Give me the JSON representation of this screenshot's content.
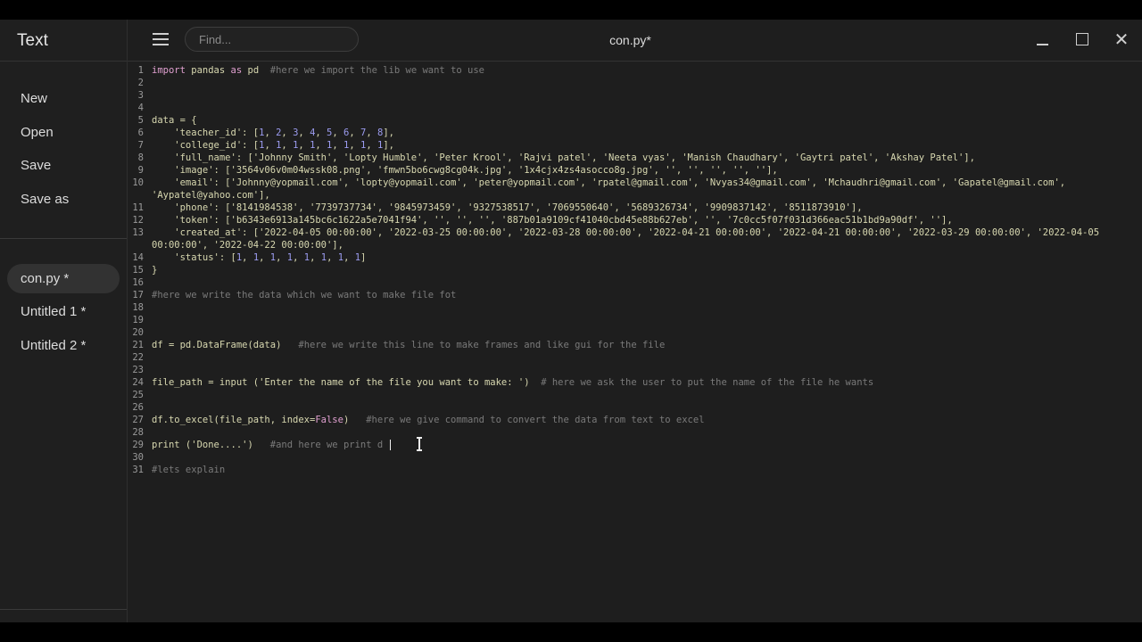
{
  "sidebar": {
    "title": "Text",
    "menu": [
      "New",
      "Open",
      "Save",
      "Save as"
    ],
    "documents": [
      {
        "label": "con.py *",
        "active": true
      },
      {
        "label": "Untitled 1 *",
        "active": false
      },
      {
        "label": "Untitled 2 *",
        "active": false
      }
    ]
  },
  "toolbar": {
    "search_placeholder": "Find...",
    "document_title": "con.py*",
    "close_glyph": "✕"
  },
  "editor": {
    "lines": [
      {
        "n": "1",
        "html": [
          [
            "kw",
            "import"
          ],
          [
            "code",
            " pandas "
          ],
          [
            "kw",
            "as"
          ],
          [
            "code",
            " pd  "
          ],
          [
            "cm",
            "#here we import the lib we want to use"
          ]
        ]
      },
      {
        "n": "2",
        "html": []
      },
      {
        "n": "3",
        "html": []
      },
      {
        "n": "4",
        "html": []
      },
      {
        "n": "5",
        "html": [
          [
            "code",
            "data = {"
          ]
        ]
      },
      {
        "n": "6",
        "html": [
          [
            "code",
            "    'teacher_id': ["
          ],
          [
            "num",
            "1"
          ],
          [
            "code",
            ", "
          ],
          [
            "num",
            "2"
          ],
          [
            "code",
            ", "
          ],
          [
            "num",
            "3"
          ],
          [
            "code",
            ", "
          ],
          [
            "num",
            "4"
          ],
          [
            "code",
            ", "
          ],
          [
            "num",
            "5"
          ],
          [
            "code",
            ", "
          ],
          [
            "num",
            "6"
          ],
          [
            "code",
            ", "
          ],
          [
            "num",
            "7"
          ],
          [
            "code",
            ", "
          ],
          [
            "num",
            "8"
          ],
          [
            "code",
            "],"
          ]
        ]
      },
      {
        "n": "7",
        "html": [
          [
            "code",
            "    'college_id': ["
          ],
          [
            "num",
            "1"
          ],
          [
            "code",
            ", "
          ],
          [
            "num",
            "1"
          ],
          [
            "code",
            ", "
          ],
          [
            "num",
            "1"
          ],
          [
            "code",
            ", "
          ],
          [
            "num",
            "1"
          ],
          [
            "code",
            ", "
          ],
          [
            "num",
            "1"
          ],
          [
            "code",
            ", "
          ],
          [
            "num",
            "1"
          ],
          [
            "code",
            ", "
          ],
          [
            "num",
            "1"
          ],
          [
            "code",
            ", "
          ],
          [
            "num",
            "1"
          ],
          [
            "code",
            "],"
          ]
        ]
      },
      {
        "n": "8",
        "html": [
          [
            "code",
            "    'full_name': ['Johnny Smith', 'Lopty Humble', 'Peter Krool', 'Rajvi patel', 'Neeta vyas', 'Manish Chaudhary', 'Gaytri patel', 'Akshay Patel'],"
          ]
        ]
      },
      {
        "n": "9",
        "html": [
          [
            "code",
            "    'image': ['3564v06v0m04wssk08.png', 'fmwn5bo6cwg8cg04k.jpg', '1x4cjx4zs4asocco8g.jpg', '', '', '', '', ''],"
          ]
        ]
      },
      {
        "n": "10",
        "html": [
          [
            "code",
            "    'email': ['Johnny@yopmail.com', 'lopty@yopmail.com', 'peter@yopmail.com', 'rpatel@gmail.com', 'Nvyas34@gmail.com', 'Mchaudhri@gmail.com', 'Gapatel@gmail.com',"
          ]
        ]
      },
      {
        "n": "",
        "html": [
          [
            "code",
            "'Aypatel@yahoo.com'],"
          ]
        ]
      },
      {
        "n": "11",
        "html": [
          [
            "code",
            "    'phone': ['8141984538', '7739737734', '9845973459', '9327538517', '7069550640', '5689326734', '9909837142', '8511873910'],"
          ]
        ]
      },
      {
        "n": "12",
        "html": [
          [
            "code",
            "    'token': ['b6343e6913a145bc6c1622a5e7041f94', '', '', '', '887b01a9109cf41040cbd45e88b627eb', '', '7c0cc5f07f031d366eac51b1bd9a90df', ''],"
          ]
        ]
      },
      {
        "n": "13",
        "html": [
          [
            "code",
            "    'created_at': ['2022-04-05 00:00:00', '2022-03-25 00:00:00', '2022-03-28 00:00:00', '2022-04-21 00:00:00', '2022-04-21 00:00:00', '2022-03-29 00:00:00', '2022-04-05"
          ]
        ]
      },
      {
        "n": "",
        "html": [
          [
            "code",
            "00:00:00', '2022-04-22 00:00:00'],"
          ]
        ]
      },
      {
        "n": "14",
        "html": [
          [
            "code",
            "    'status': ["
          ],
          [
            "num",
            "1"
          ],
          [
            "code",
            ", "
          ],
          [
            "num",
            "1"
          ],
          [
            "code",
            ", "
          ],
          [
            "num",
            "1"
          ],
          [
            "code",
            ", "
          ],
          [
            "num",
            "1"
          ],
          [
            "code",
            ", "
          ],
          [
            "num",
            "1"
          ],
          [
            "code",
            ", "
          ],
          [
            "num",
            "1"
          ],
          [
            "code",
            ", "
          ],
          [
            "num",
            "1"
          ],
          [
            "code",
            ", "
          ],
          [
            "num",
            "1"
          ],
          [
            "code",
            "]"
          ]
        ]
      },
      {
        "n": "15",
        "html": [
          [
            "code",
            "}"
          ]
        ]
      },
      {
        "n": "16",
        "html": []
      },
      {
        "n": "17",
        "html": [
          [
            "cm",
            "#here we write the data which we want to make file fot"
          ]
        ]
      },
      {
        "n": "18",
        "html": []
      },
      {
        "n": "19",
        "html": []
      },
      {
        "n": "20",
        "html": []
      },
      {
        "n": "21",
        "html": [
          [
            "code",
            "df = pd.DataFrame(data)   "
          ],
          [
            "cm",
            "#here we write this line to make frames and like gui for the file"
          ]
        ]
      },
      {
        "n": "22",
        "html": []
      },
      {
        "n": "23",
        "html": []
      },
      {
        "n": "24",
        "html": [
          [
            "code",
            "file_path = input ('Enter the name of the file you want to make: ')  "
          ],
          [
            "cm",
            "# here we ask the user to put the name of the file he wants"
          ]
        ]
      },
      {
        "n": "25",
        "html": []
      },
      {
        "n": "26",
        "html": []
      },
      {
        "n": "27",
        "html": [
          [
            "code",
            "df.to_excel(file_path, index="
          ],
          [
            "kw",
            "False"
          ],
          [
            "code",
            ")   "
          ],
          [
            "cm",
            "#here we give command to convert the data from text to excel"
          ]
        ]
      },
      {
        "n": "28",
        "html": []
      },
      {
        "n": "29",
        "html": [
          [
            "code",
            "print ('Done....')   "
          ],
          [
            "cm",
            "#and here we print d"
          ]
        ]
      },
      {
        "n": "30",
        "html": []
      },
      {
        "n": "31",
        "html": [
          [
            "cm",
            "#lets explain"
          ]
        ]
      }
    ]
  }
}
